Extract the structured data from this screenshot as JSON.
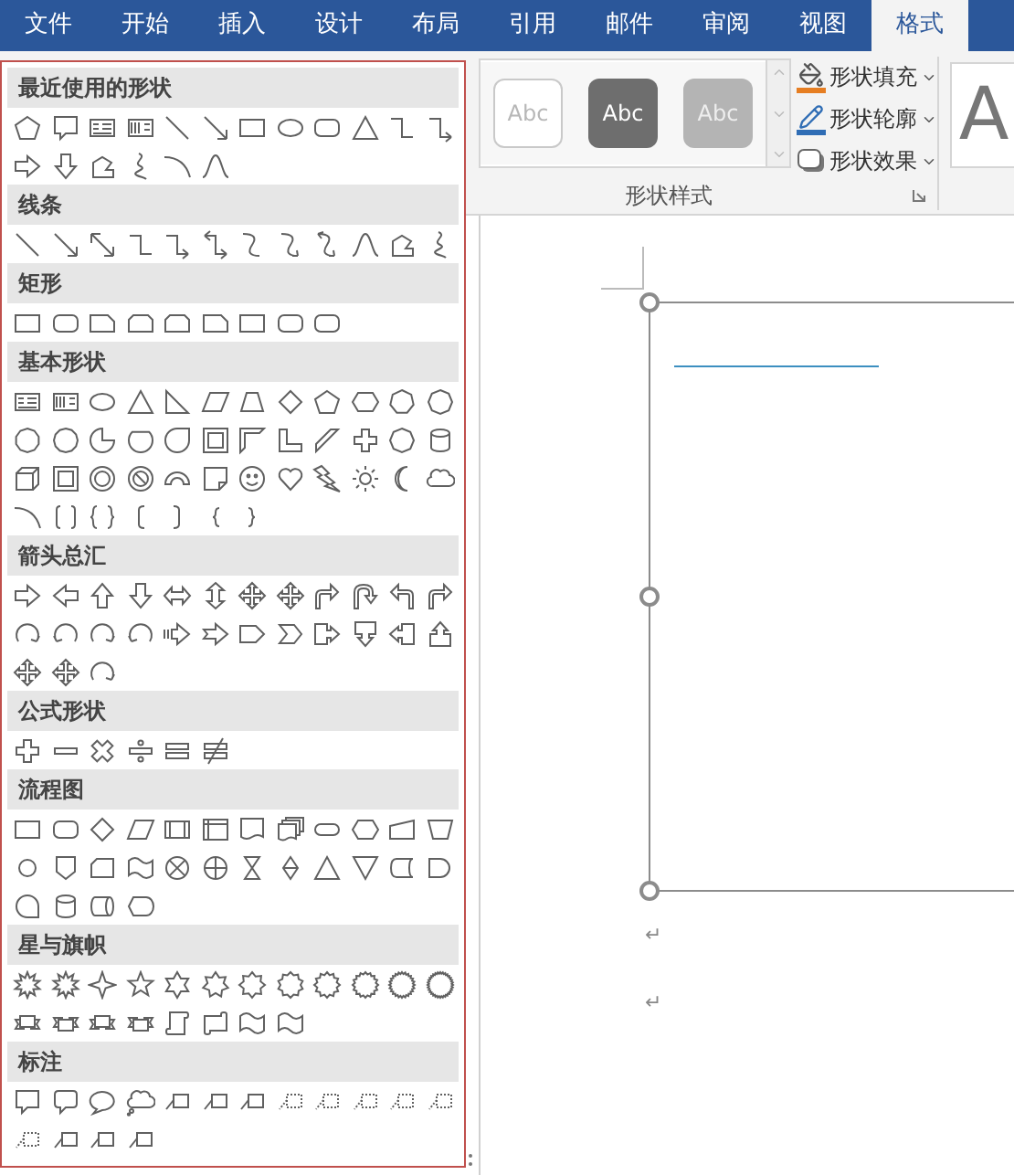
{
  "tabs": [
    {
      "label": "文件",
      "selected": false
    },
    {
      "label": "开始",
      "selected": false
    },
    {
      "label": "插入",
      "selected": false
    },
    {
      "label": "设计",
      "selected": false
    },
    {
      "label": "布局",
      "selected": false
    },
    {
      "label": "引用",
      "selected": false
    },
    {
      "label": "邮件",
      "selected": false
    },
    {
      "label": "审阅",
      "selected": false
    },
    {
      "label": "视图",
      "selected": false
    },
    {
      "label": "格式",
      "selected": true
    }
  ],
  "ribbon": {
    "style_swatches": [
      {
        "label": "Abc",
        "kind": "light"
      },
      {
        "label": "Abc",
        "kind": "dark"
      },
      {
        "label": "Abc",
        "kind": "grey"
      }
    ],
    "commands": [
      {
        "label": "形状填充",
        "kind": "fill"
      },
      {
        "label": "形状轮廓",
        "kind": "outline"
      },
      {
        "label": "形状效果",
        "kind": "effects"
      }
    ],
    "group_label": "形状样式",
    "wordart_preview": "A"
  },
  "shape_gallery": {
    "sections": [
      {
        "title": "最近使用的形状",
        "kind": "recent"
      },
      {
        "title": "线条",
        "kind": "lines"
      },
      {
        "title": "矩形",
        "kind": "rectangles"
      },
      {
        "title": "基本形状",
        "kind": "basic"
      },
      {
        "title": "箭头总汇",
        "kind": "arrows"
      },
      {
        "title": "公式形状",
        "kind": "equation"
      },
      {
        "title": "流程图",
        "kind": "flowchart"
      },
      {
        "title": "星与旗帜",
        "kind": "stars"
      },
      {
        "title": "标注",
        "kind": "callouts"
      }
    ]
  },
  "document": {
    "paragraph_marks": [
      "↵",
      "↵"
    ]
  }
}
